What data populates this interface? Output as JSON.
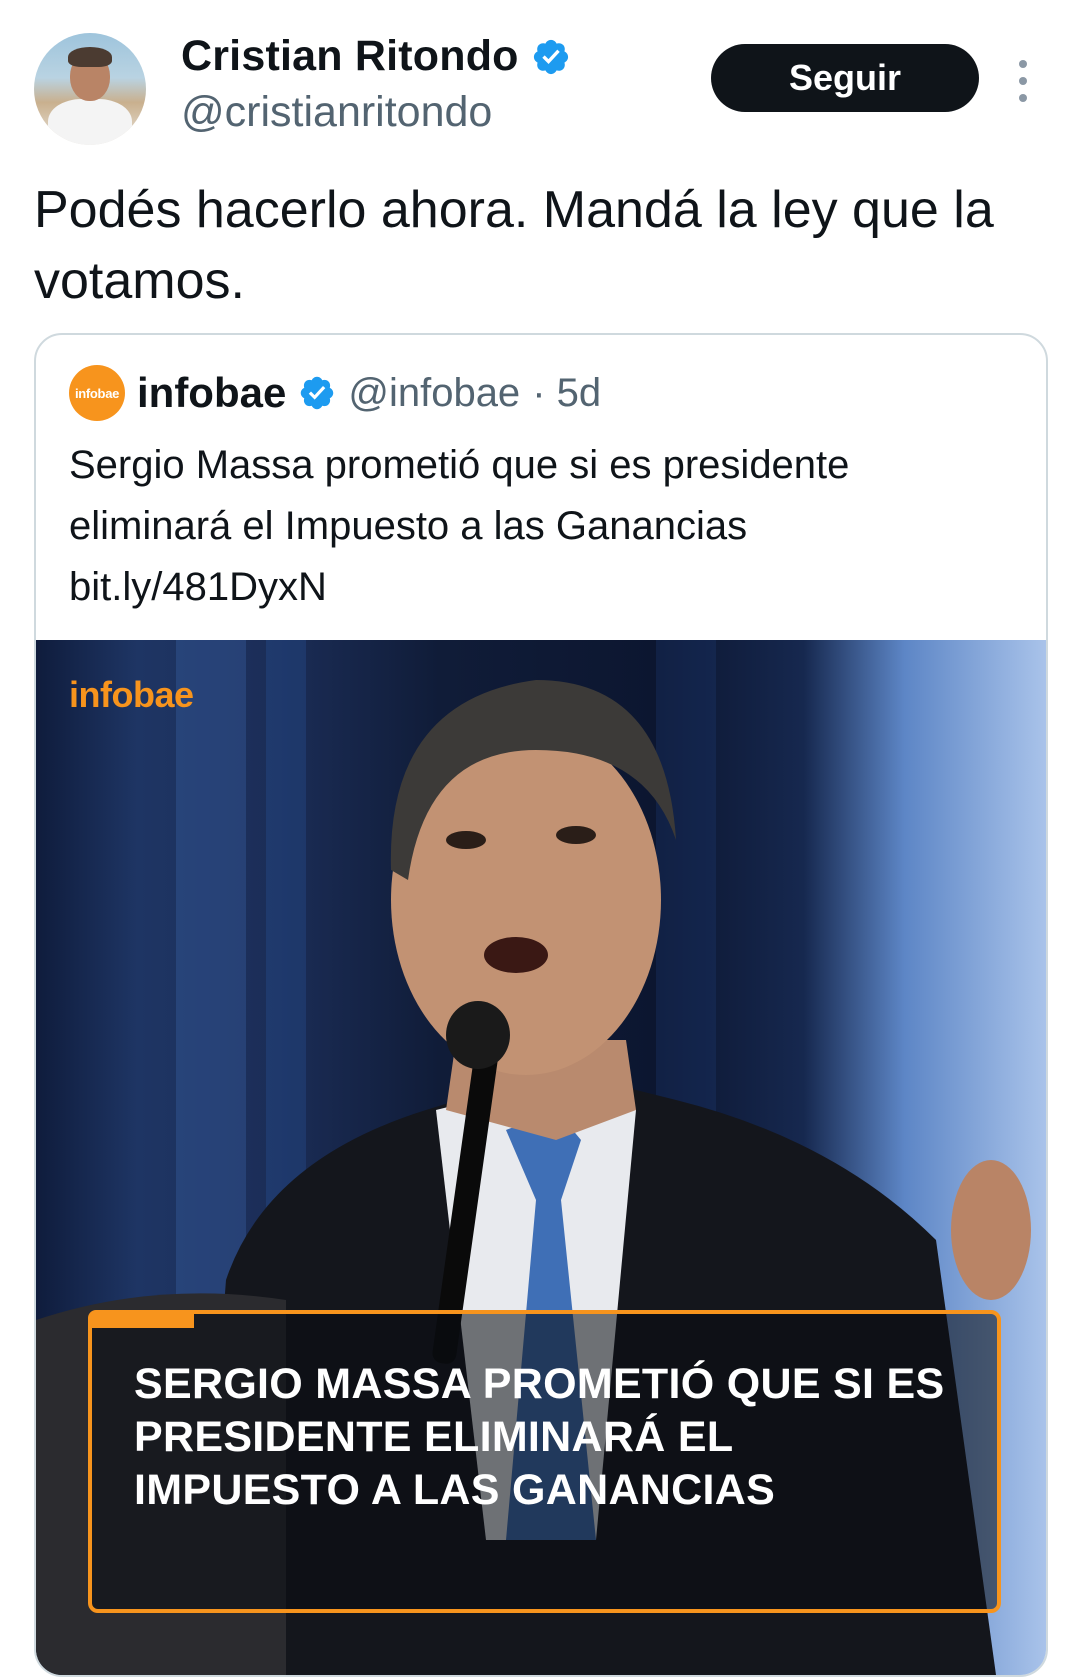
{
  "author": {
    "name": "Cristian Ritondo",
    "handle": "@cristianritondo",
    "verified_icon": "verified-badge-icon"
  },
  "actions": {
    "follow_label": "Seguir",
    "more_icon": "more-vertical-icon"
  },
  "tweet": {
    "text": "Podés hacerlo ahora. Mandá la ley que la votamos."
  },
  "quoted": {
    "logo_text": "infobae",
    "name": "infobae",
    "handle": "@infobae",
    "time": "· 5d",
    "text": "Sergio Massa prometió que si es presidente eliminará el Impuesto a las Ganancias bit.ly/481DyxN",
    "media": {
      "brand": "infobae",
      "caption": "SERGIO MASSA PROMETIÓ QUE SI ES PRESIDENTE ELIMINARÁ EL IMPUESTO A LAS GANANCIAS"
    }
  },
  "colors": {
    "verified_blue": "#1d9bf0",
    "infobae_orange": "#f7941d",
    "follow_bg": "#0f1419"
  }
}
